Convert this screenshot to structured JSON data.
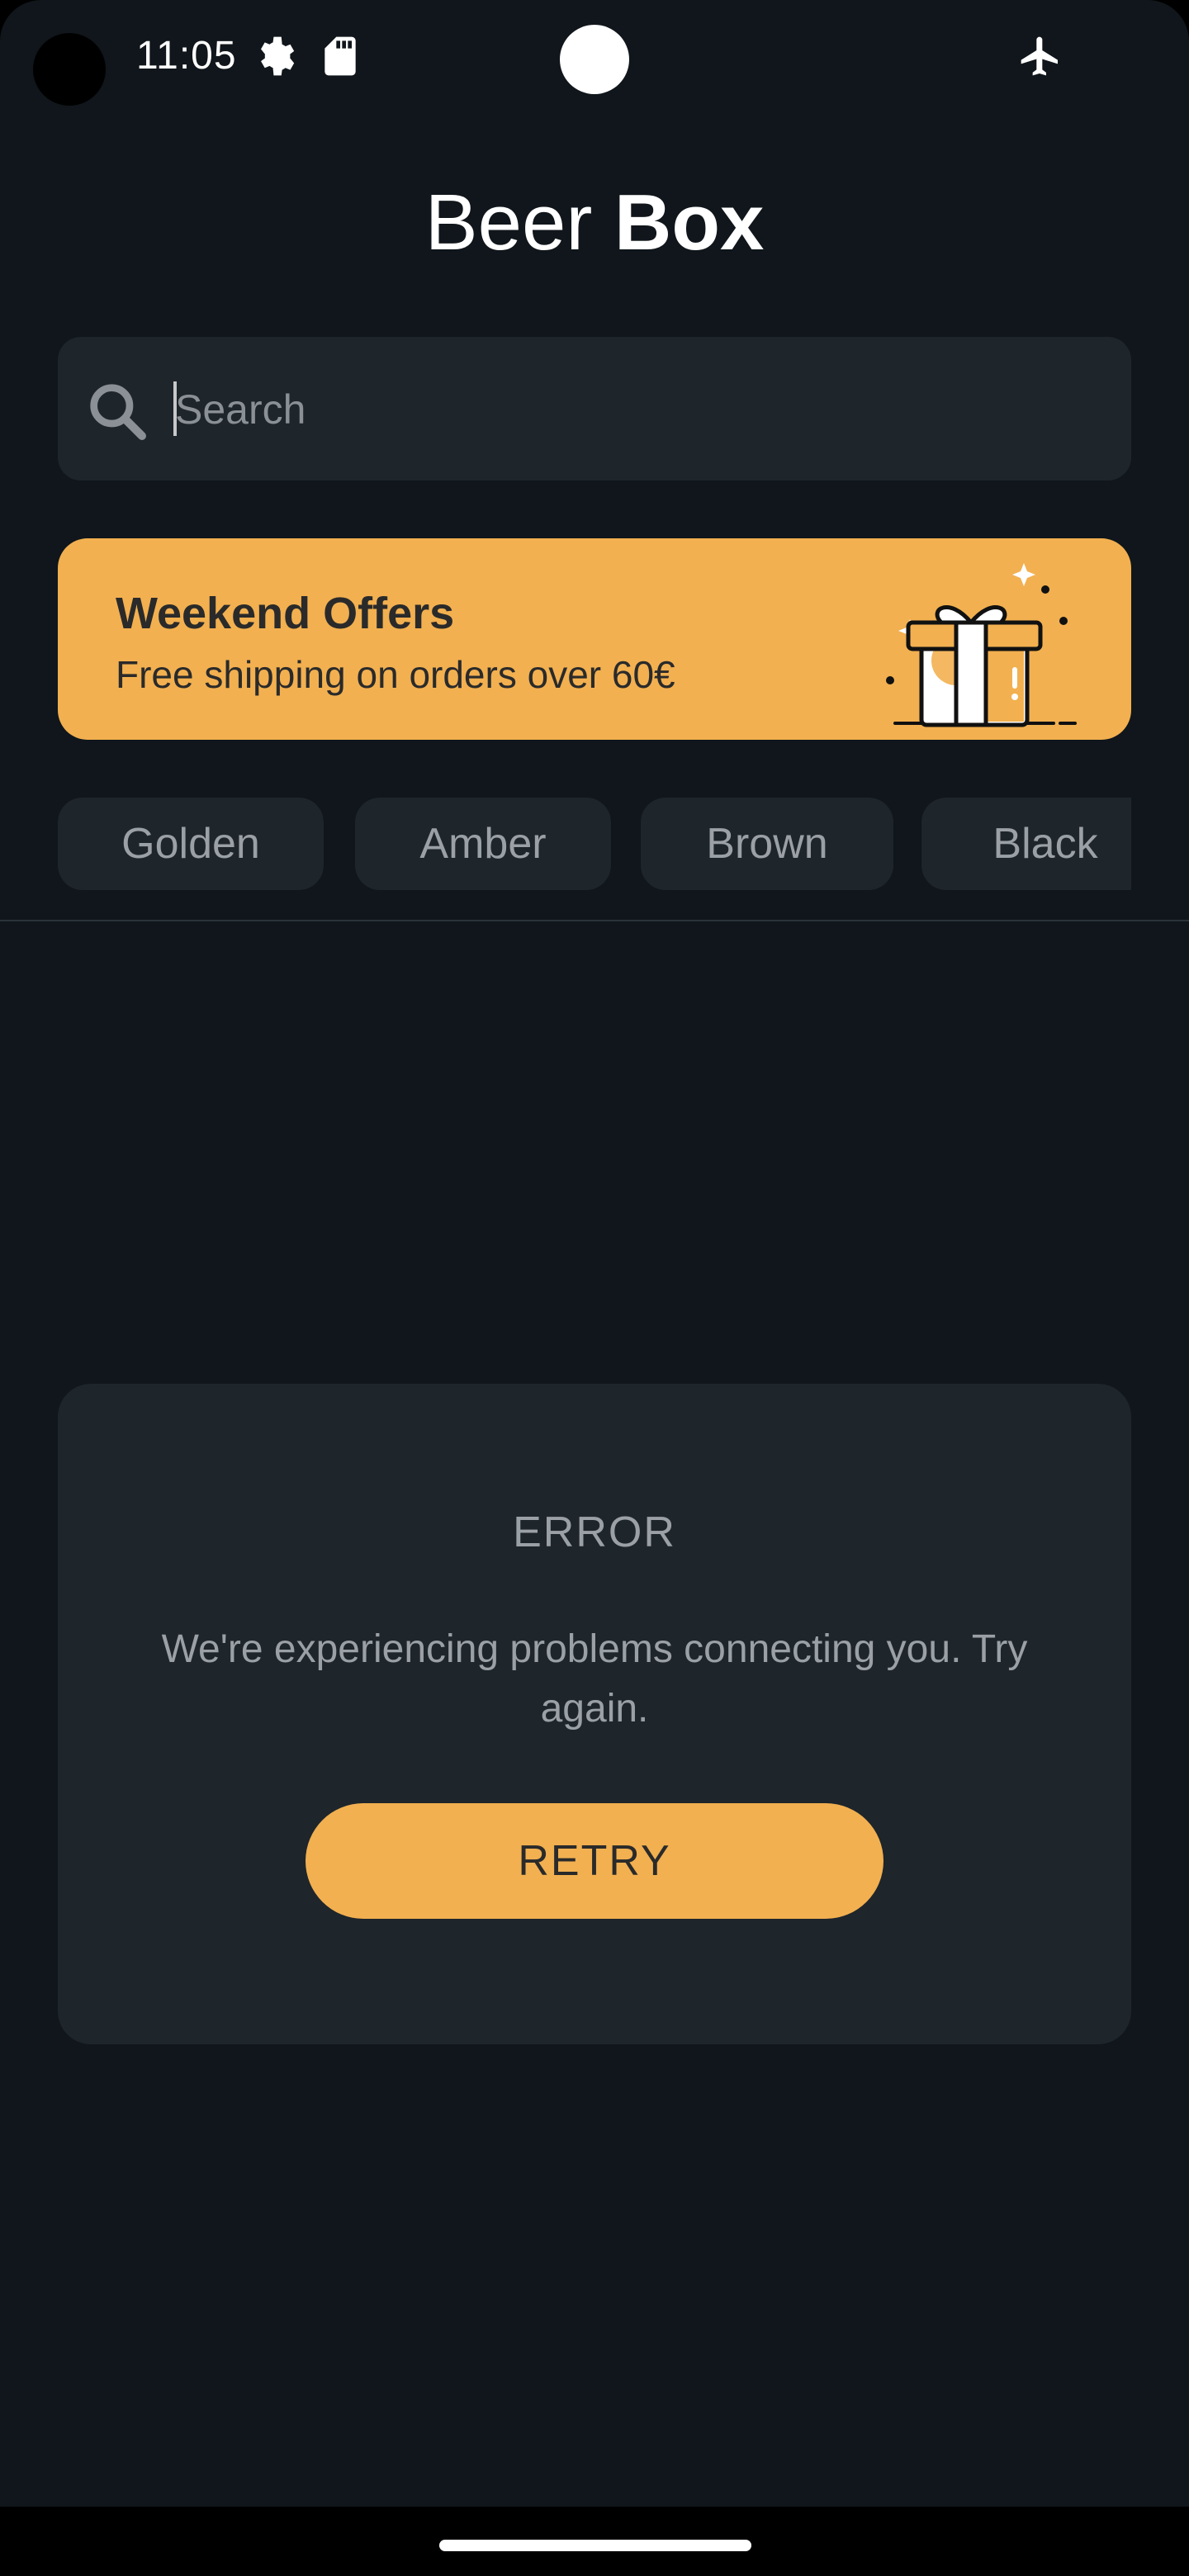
{
  "status_bar": {
    "time": "11:05",
    "icons": [
      "settings-icon",
      "sd-card-icon",
      "airplane-mode-icon"
    ]
  },
  "app": {
    "title_light": "Beer",
    "title_bold": "Box"
  },
  "search": {
    "placeholder": "Search",
    "value": ""
  },
  "banner": {
    "title": "Weekend Offers",
    "subtitle": "Free shipping on orders over 60€",
    "icon": "gift-icon",
    "color": "#f2b050"
  },
  "categories": [
    {
      "label": "Golden"
    },
    {
      "label": "Amber"
    },
    {
      "label": "Brown"
    },
    {
      "label": "Black"
    }
  ],
  "error": {
    "title": "ERROR",
    "message": "We're experiencing problems connecting you. Try again.",
    "retry_label": "RETRY"
  },
  "colors": {
    "background": "#10161b",
    "surface": "#1e252b",
    "accent": "#f2b050",
    "muted_text": "#9aa0a6"
  }
}
